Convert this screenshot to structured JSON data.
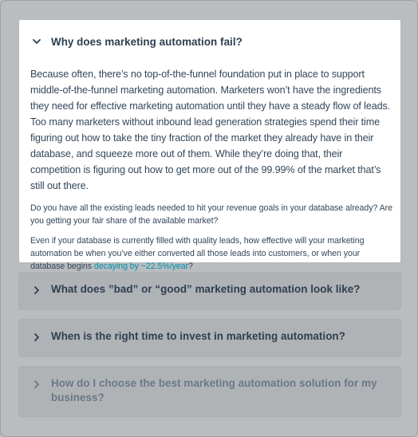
{
  "faq": {
    "open_item": {
      "question": "Why does marketing automation fail?",
      "icon": "chevron-down-icon",
      "paragraph_1": "Because often, there’s no top-of-the-funnel foundation put in place to support middle-of-the-funnel marketing automation. Marketers won’t have the ingredients they need for effective marketing automation until they have a steady flow of leads. Too many marketers without inbound lead generation strategies spend their time figuring out how to take the tiny fraction of the market they already have in their database, and squeeze more out of them. While they’re doing that, their competition is figuring out how to get more out of the 99.99% of the market that’s still out there.",
      "paragraph_2": "Do you have all the existing leads needed to hit your revenue goals in your database already? Are you getting your fair share of the available market?",
      "paragraph_3_before": "Even if your database is currently filled with quality leads, how effective will your marketing automation be when you’ve either converted all those leads into customers, or when your database begins ",
      "paragraph_3_link": "decaying by ~22.5%/year",
      "paragraph_3_after": "?"
    },
    "closed_items": [
      {
        "question": "What does ”bad” or “good” marketing automation look like?",
        "icon": "chevron-right-icon"
      },
      {
        "question": "When is the right time to invest in marketing automation?",
        "icon": "chevron-right-icon"
      },
      {
        "question": "How do I choose the best marketing automation solution for my business?",
        "icon": "chevron-right-icon"
      }
    ]
  },
  "colors": {
    "heading": "#2d3e50",
    "body_text": "#33475b",
    "link": "#0091ae",
    "overlay": "#b7babd",
    "panel": "#ffffff"
  }
}
